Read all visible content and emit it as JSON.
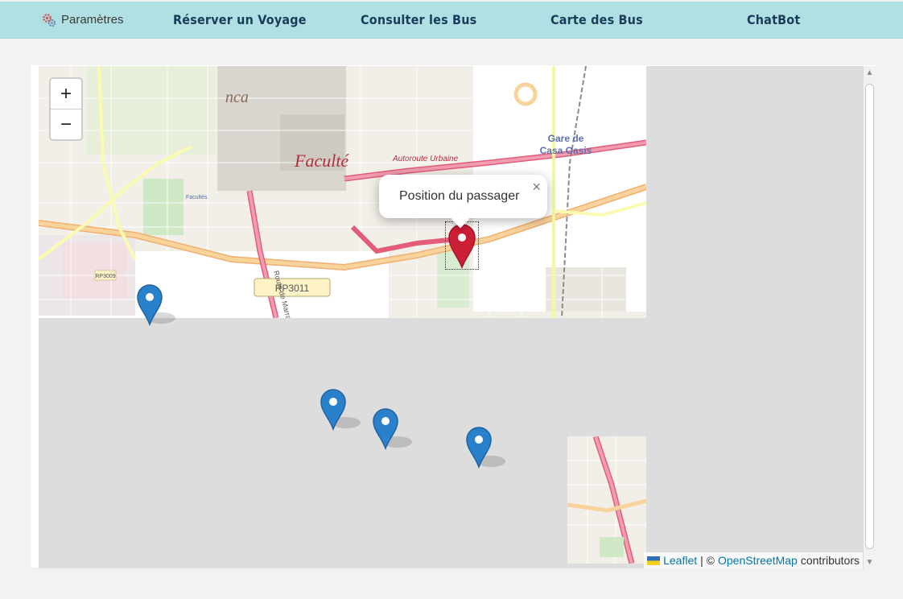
{
  "navbar": {
    "settings_label": "Paramètres",
    "links": [
      "Réserver un Voyage",
      "Consulter les Bus",
      "Carte des Bus",
      "ChatBot"
    ]
  },
  "map": {
    "zoom_in": "+",
    "zoom_out": "−",
    "popup": {
      "text": "Position du passager",
      "close": "×"
    },
    "labels": {
      "gare": "Gare de",
      "casa_oasis": "Casa Oasis",
      "faculte": "Faculté",
      "rp3011": "RP3011",
      "rp3009": "RP3009",
      "autoroute": "Autoroute Urbaine",
      "route_marrakech": "Route de Marrakech",
      "facultes": "Facultés",
      "casablanca_fragment": "nca"
    },
    "markers": {
      "passenger": "red",
      "buses": [
        "blue",
        "blue",
        "blue",
        "blue"
      ]
    },
    "attribution": {
      "leaflet": "Leaflet",
      "separator": "| ©",
      "osm": "OpenStreetMap",
      "contributors": "contributors"
    }
  },
  "colors": {
    "navbar": "#b0e0e3",
    "nav_text": "#1a3c5a",
    "map_bg": "#dddddd",
    "passenger_marker": "#cc1f35",
    "bus_marker": "#2a81cb",
    "link": "#0078a8"
  }
}
